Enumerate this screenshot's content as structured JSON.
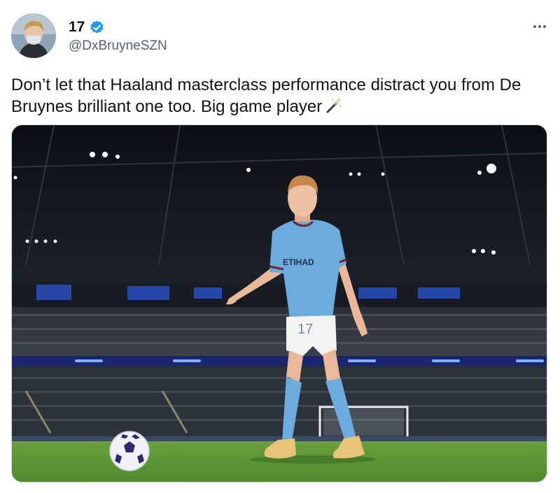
{
  "author": {
    "display_name": "17",
    "handle": "@DxBruyneSZN",
    "verified": true,
    "avatar_icon": "profile-photo"
  },
  "tweet": {
    "text": "Don’t let that Haaland masterclass performance distract you from De Bruynes brilliant one too. Big game player",
    "emoji_icon": "magic-wand-icon"
  },
  "media": {
    "type": "photo",
    "shirt_sponsor": "ETIHAD",
    "shirt_number": "17"
  },
  "colors": {
    "verified_blue": "#1d9bf0",
    "text_primary": "#0f1419",
    "text_secondary": "#536471",
    "kit_sky_blue": "#6cabdd"
  }
}
